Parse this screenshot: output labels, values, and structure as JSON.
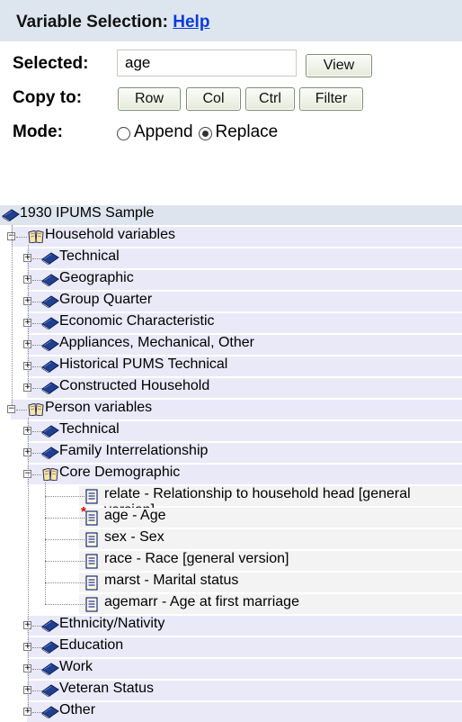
{
  "header": {
    "title": "Variable Selection:",
    "help_link": "Help"
  },
  "controls": {
    "selected_label": "Selected:",
    "selected_value": "age",
    "view_button": "View",
    "copy_label": "Copy to:",
    "copy_buttons": [
      "Row",
      "Col",
      "Ctrl",
      "Filter"
    ],
    "mode_label": "Mode:",
    "mode_options": [
      "Append",
      "Replace"
    ],
    "mode_selected": "Replace"
  },
  "tree": {
    "root": "1930 IPUMS Sample",
    "household": {
      "label": "Household variables",
      "children": [
        "Technical",
        "Geographic",
        "Group Quarter",
        "Economic Characteristic",
        "Appliances, Mechanical, Other",
        "Historical PUMS Technical",
        "Constructed Household"
      ]
    },
    "person": {
      "label": "Person variables",
      "children_before": [
        "Technical",
        "Family Interrelationship"
      ],
      "core": {
        "label": "Core Demographic",
        "variables": [
          "relate - Relationship to household head [general version]",
          "age - Age",
          "sex - Sex",
          "race - Race [general version]",
          "marst - Marital status",
          "agemarr - Age at first marriage"
        ],
        "selected_variable": "age - Age"
      },
      "children_after": [
        "Ethnicity/Nativity",
        "Education",
        "Work",
        "Veteran Status",
        "Other"
      ]
    }
  },
  "colors": {
    "header_bg": "#dde6ef",
    "link": "#0b3cd6",
    "row_highlight": "#e9e9f8",
    "book": "#1f3f8f"
  }
}
